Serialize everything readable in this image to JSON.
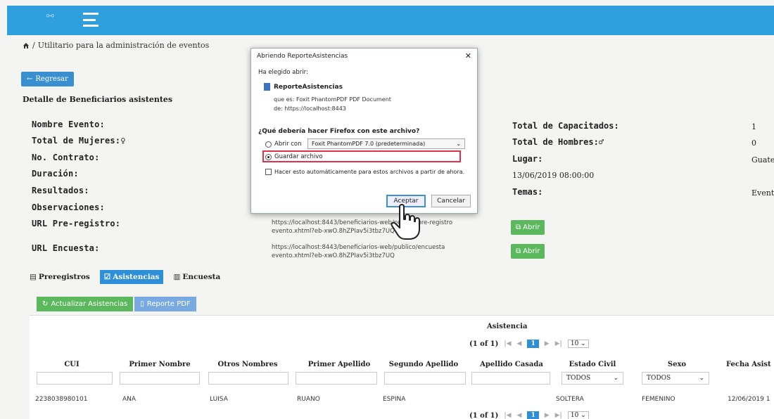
{
  "header": {
    "logo": "⚯"
  },
  "breadcrumb": {
    "separator": "/",
    "current": "Utilitario para la administración de eventos"
  },
  "back_button": {
    "label": "Regresar"
  },
  "page_subtitle": "Detalle de Beneficiarios asistentes",
  "fields": {
    "nombre_evento": "Nombre Evento:",
    "total_mujeres": "Total de Mujeres:",
    "no_contrato": "No. Contrato:",
    "duracion": "Duración:",
    "resultados": "Resultados:",
    "observaciones": "Observaciones:",
    "url_preregistro": "URL Pre-registro:",
    "url_encuesta": "URL Encuesta:"
  },
  "right_fields": {
    "total_capacitados": {
      "label": "Total de Capacitados:",
      "value": "1"
    },
    "total_hombres": {
      "label": "Total de Hombres:",
      "value": "0"
    },
    "lugar": {
      "label": "Lugar:",
      "value": "Guate"
    },
    "fecha": "13/06/2019 08:00:00",
    "temas": {
      "label": "Temas:",
      "value": "Event"
    }
  },
  "urls": {
    "preregistro": "https://localhost:8443/beneficiarios-web/publico/pre-registro evento.xhtml?eb-xwO.8hZPIav5i3tbz7UQ",
    "encuesta": "https://localhost:8443/beneficiarios-web/publico/encuesta evento.xhtml?eb-xwO.8hZPIav5i3tbz7UQ"
  },
  "abrir_label": "Abrir",
  "tabs": [
    {
      "label": "Preregistros"
    },
    {
      "label": "Asistencias"
    },
    {
      "label": "Encuesta"
    }
  ],
  "actions": {
    "actualizar": "Actualizar Asistencias",
    "reporte": "Reporte PDF"
  },
  "table": {
    "caption": "Asistencia",
    "pager": {
      "info": "(1 of 1)",
      "current": "1",
      "per_page": "10"
    },
    "columns": [
      "CUI",
      "Primer Nombre",
      "Otros Nombres",
      "Primer Apellido",
      "Segundo Apellido",
      "Apellido Casada",
      "Estado Civil",
      "Sexo",
      "Fecha Asist"
    ],
    "filters": {
      "estado_civil": "TODOS",
      "sexo": "TODOS"
    },
    "rows": [
      {
        "cui": "2238038980101",
        "primer_nombre": "ANA",
        "otros_nombres": "LUISA",
        "primer_apellido": "RUANO",
        "segundo_apellido": "ESPINA",
        "apellido_casada": "",
        "estado_civil": "SOLTERA",
        "sexo": "FEMENINO",
        "fecha": "12/06/2019 1"
      }
    ]
  },
  "dialog": {
    "title": "Abriendo ReporteAsistencias",
    "chosen": "Ha elegido abrir:",
    "file_name": "ReporteAsistencias",
    "file_type": "que es: Foxit PhantomPDF PDF Document",
    "file_source": "de: https://localhost:8443",
    "question": "¿Qué debería hacer Firefox con este archivo?",
    "open_with_label": "Abrir con",
    "open_with_app": "Foxit PhantomPDF 7.0 (predeterminada)",
    "save_label": "Guardar archivo",
    "auto_label": "Hacer esto automáticamente para estos archivos a partir de ahora.",
    "accept": "Aceptar",
    "cancel": "Cancelar"
  }
}
